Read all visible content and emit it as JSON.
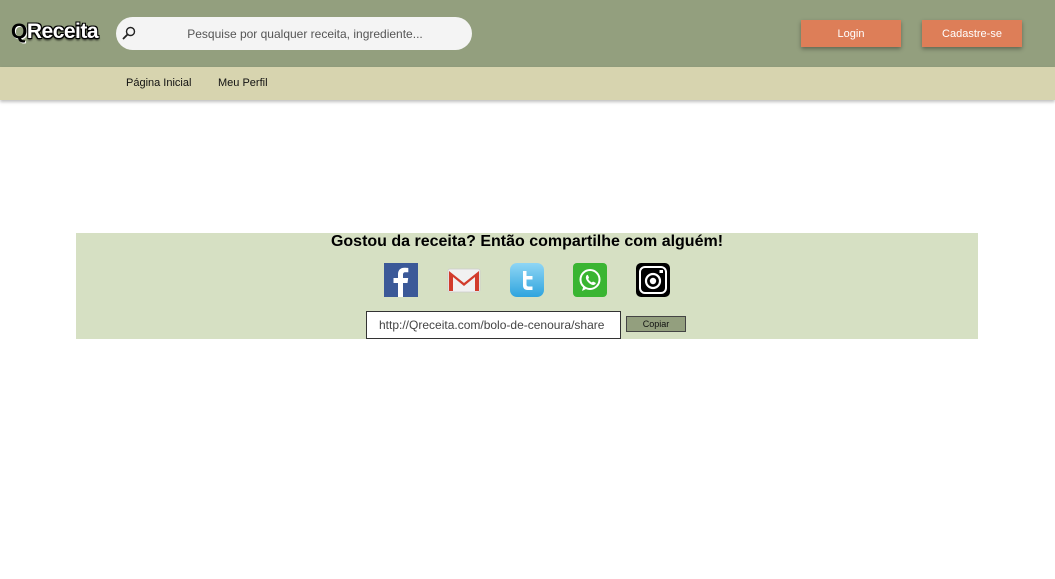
{
  "header": {
    "logo_q": "Q",
    "logo_text": "Receita",
    "search_placeholder": "Pesquise por qualquer receita, ingrediente...",
    "login_label": "Login",
    "signup_label": "Cadastre-se"
  },
  "nav": {
    "items": [
      {
        "label": "Página Inicial"
      },
      {
        "label": "Meu Perfil"
      }
    ]
  },
  "share": {
    "title": "Gostou da receita? Então compartilhe com alguém!",
    "networks": [
      "facebook-icon",
      "gmail-icon",
      "twitter-icon",
      "whatsapp-icon",
      "instagram-icon"
    ],
    "link_value": "http://Qreceita.com/bolo-de-cenoura/share",
    "copy_label": "Copiar"
  },
  "colors": {
    "header_bg": "#939f7e",
    "nav_bg": "#d7d4af",
    "button_bg": "#dd7e58",
    "share_bg": "#d6e0c3"
  }
}
